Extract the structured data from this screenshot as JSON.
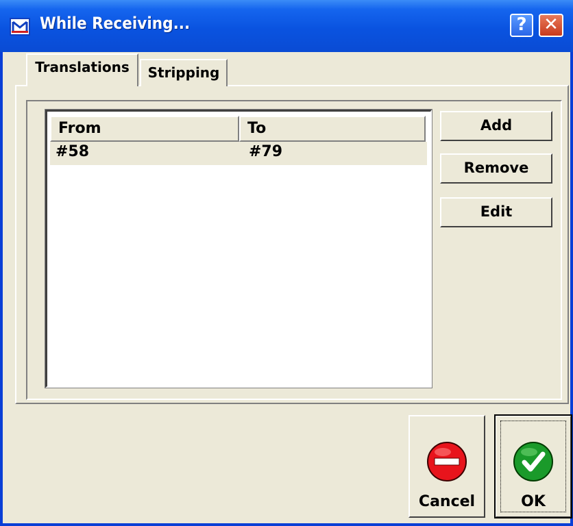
{
  "window": {
    "title": "While Receiving..."
  },
  "titlebar": {
    "help_label": "?",
    "close_label": "✕"
  },
  "tabs": [
    {
      "label": "Translations",
      "active": true
    },
    {
      "label": "Stripping",
      "active": false
    }
  ],
  "list": {
    "columns": [
      "From",
      "To"
    ],
    "rows": [
      {
        "from": "#58",
        "to": "#79"
      }
    ]
  },
  "side_buttons": {
    "add": "Add",
    "remove": "Remove",
    "edit": "Edit"
  },
  "footer": {
    "cancel_label": "Cancel",
    "ok_label": "OK"
  },
  "colors": {
    "title_bar": "#0a53e0",
    "dialog_bg": "#ece9d8",
    "cancel_icon": "#e8141c",
    "ok_icon": "#1a9a2a"
  },
  "icons": {
    "app": "mailbox-logo-icon",
    "cancel": "no-entry-icon",
    "ok": "checkmark-icon"
  }
}
